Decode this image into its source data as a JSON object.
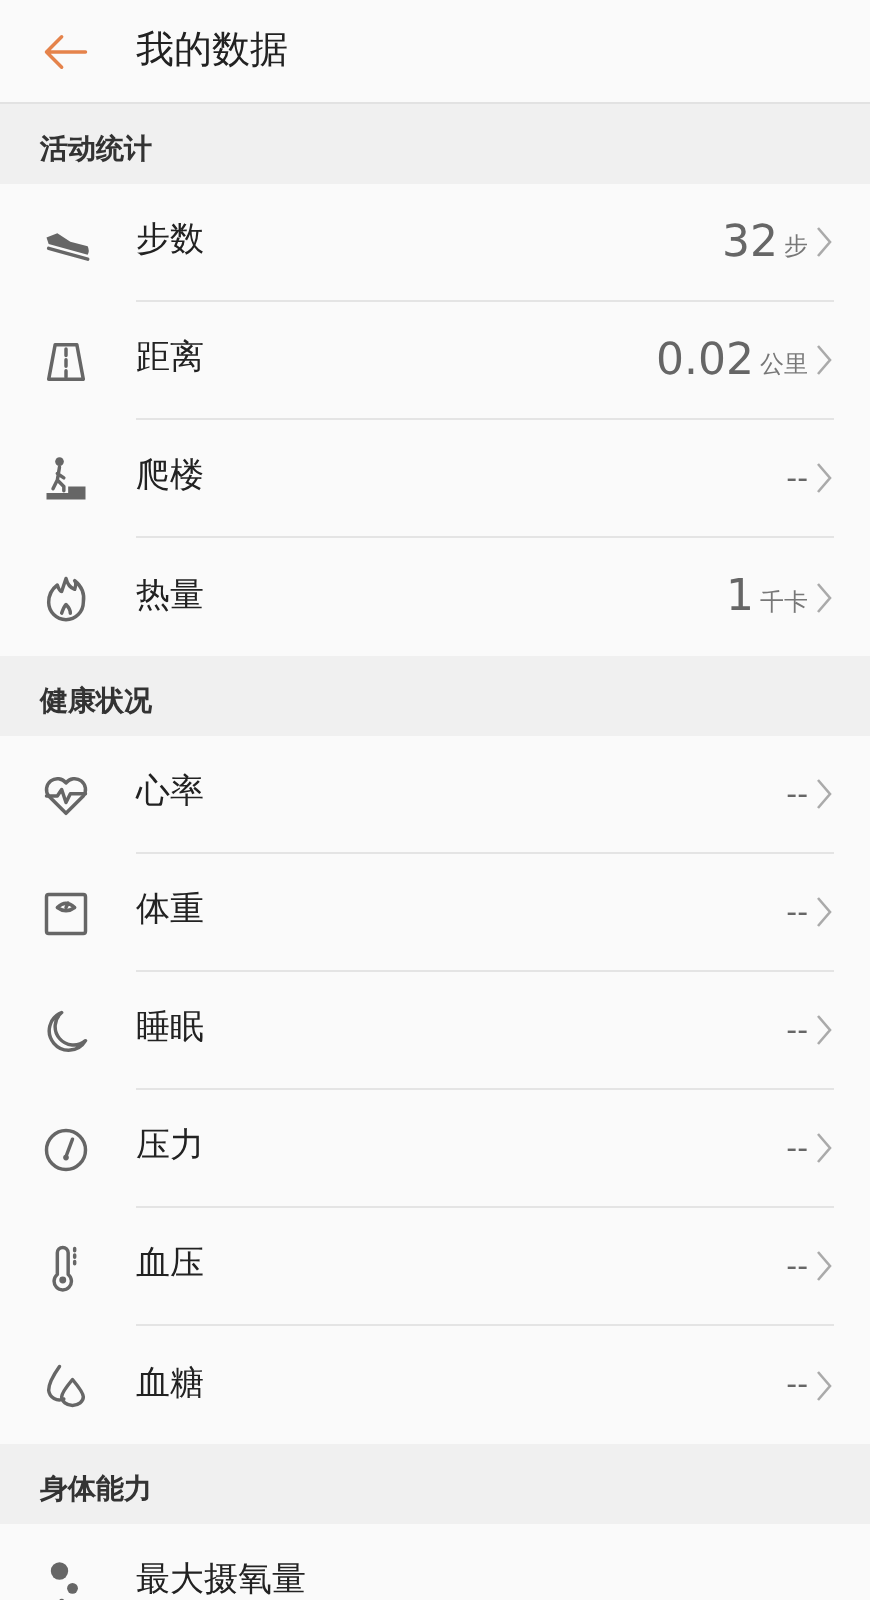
{
  "header": {
    "title": "我的数据"
  },
  "sections": [
    {
      "title": "活动统计",
      "rows": [
        {
          "label": "步数",
          "value": "32",
          "unit": "步"
        },
        {
          "label": "距离",
          "value": "0.02",
          "unit": "公里"
        },
        {
          "label": "爬楼",
          "value": "--"
        },
        {
          "label": "热量",
          "value": "1",
          "unit": "千卡"
        }
      ]
    },
    {
      "title": "健康状况",
      "rows": [
        {
          "label": "心率",
          "value": "--"
        },
        {
          "label": "体重",
          "value": "--"
        },
        {
          "label": "睡眠",
          "value": "--"
        },
        {
          "label": "压力",
          "value": "--"
        },
        {
          "label": "血压",
          "value": "--"
        },
        {
          "label": "血糖",
          "value": "--"
        }
      ]
    },
    {
      "title": "身体能力",
      "rows": [
        {
          "label": "最大摄氧量"
        }
      ]
    }
  ]
}
